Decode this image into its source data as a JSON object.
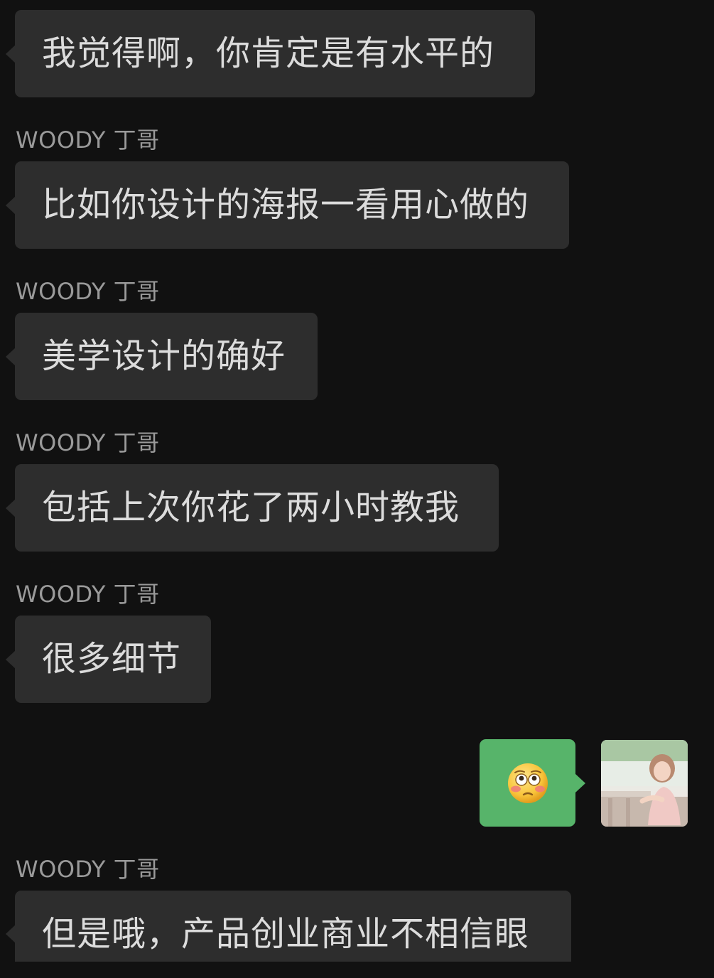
{
  "chat": {
    "messages": [
      {
        "sender": "",
        "text": "我觉得啊，你肯定是有水平的"
      },
      {
        "sender": "WOODY 丁哥",
        "text": "比如你设计的海报一看用心做的"
      },
      {
        "sender": "WOODY 丁哥",
        "text": "美学设计的确好"
      },
      {
        "sender": "WOODY 丁哥",
        "text": "包括上次你花了两小时教我"
      },
      {
        "sender": "WOODY 丁哥",
        "text": "很多细节"
      },
      {
        "sender": "WOODY 丁哥",
        "text": "但是哦，产品创业商业不相信眼"
      }
    ],
    "own_message": {
      "emoji": "flushed-face",
      "avatar_icon": "user-avatar-photo"
    }
  },
  "colors": {
    "background": "#111111",
    "incoming_bubble": "#2d2d2d",
    "outgoing_bubble": "#57b46a",
    "incoming_text": "#dcdcdc",
    "sender_text": "#9a9a9a"
  }
}
